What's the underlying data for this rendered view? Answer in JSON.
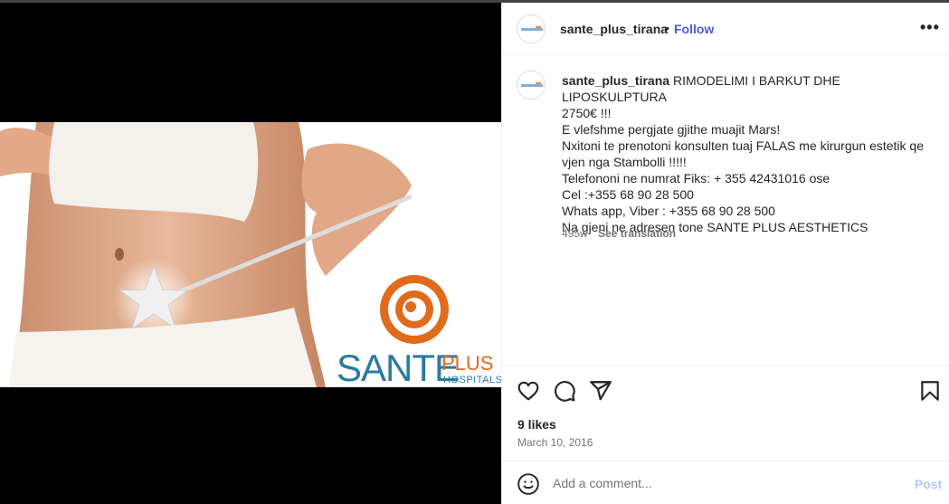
{
  "post": {
    "username": "sante_plus_tirana",
    "follow_label": "Follow",
    "separator": "•",
    "more_icon": "more-options-icon",
    "more_label": "•••"
  },
  "image": {
    "description_icon": "post-photo",
    "logo": {
      "brand_main": "SANTE",
      "brand_plus": "PLUS",
      "brand_sub": "HOSPITALS",
      "colors": {
        "swirl": "#e06b1d",
        "text": "#2b7aa3"
      }
    }
  },
  "caption": {
    "username": "sante_plus_tirana",
    "lines": [
      "RIMODELIMI I BARKUT DHE LIPOSKULPTURA",
      "2750€ !!!",
      "E vlefshme pergjate gjithe muajit Mars!",
      "Nxitoni te prenotoni konsulten tuaj FALAS me kirurgun estetik qe",
      "vjen nga Stambolli !!!!!",
      "Telefononi ne numrat Fiks: + 355 42431016 ose",
      "Cel :+355 68 90 28 500",
      "Whats app, Viber : +355 68 90 28 500",
      "Na gjeni ne adresen tone SANTE PLUS AESTHETICS"
    ],
    "age": "495w",
    "translate_label": "See translation"
  },
  "stats": {
    "likes": "9 likes",
    "date": "March 10, 2016"
  },
  "comment": {
    "placeholder": "Add a comment...",
    "post_label": "Post"
  },
  "colors": {
    "accent": "#4a5bd6",
    "post_disabled": "#b3c7f5",
    "muted": "#737373"
  }
}
